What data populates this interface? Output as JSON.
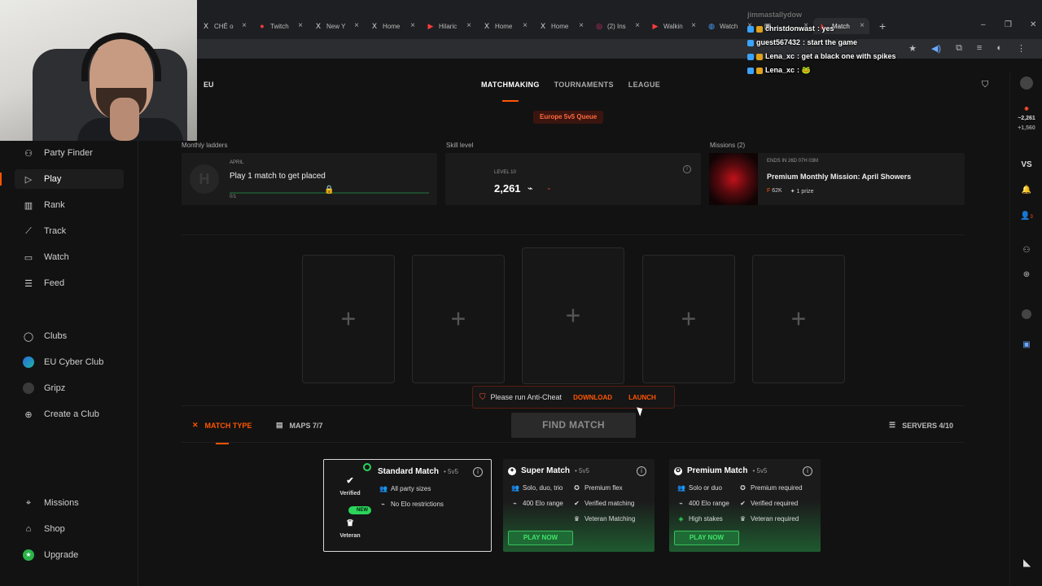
{
  "browser": {
    "tabs": [
      {
        "label": "CHÊ o",
        "icon": "x-icon",
        "fav": "X"
      },
      {
        "label": "Twitch",
        "icon": "reddit-icon",
        "fav": "●"
      },
      {
        "label": "New Y",
        "icon": "x-icon",
        "fav": "X"
      },
      {
        "label": "Home",
        "icon": "x-icon",
        "fav": "X"
      },
      {
        "label": "Hilaric",
        "icon": "youtube-icon",
        "fav": "▶"
      },
      {
        "label": "Home",
        "icon": "x-icon",
        "fav": "X"
      },
      {
        "label": "Home",
        "icon": "x-icon",
        "fav": "X"
      },
      {
        "label": "(2) Ins",
        "icon": "instagram-icon",
        "fav": "◎"
      },
      {
        "label": "Walkin",
        "icon": "youtube-icon",
        "fav": "▶"
      },
      {
        "label": "Watch",
        "icon": "globe-icon",
        "fav": "◍"
      },
      {
        "label": "",
        "icon": "twitch-icon",
        "fav": "▣"
      },
      {
        "label": "Match",
        "icon": "faceit-icon",
        "fav": "◣"
      }
    ],
    "new_tab": "+",
    "close_glyph": "×",
    "min_glyph": "–",
    "max_glyph": "❐",
    "close_win_glyph": "✕",
    "addr_icons": [
      "★",
      "◀)",
      "⧉",
      "≡",
      "◐",
      "⋮"
    ]
  },
  "chat": {
    "lines": [
      {
        "user": "jimmastallydow",
        "text": "",
        "faded": true
      },
      {
        "user": "christdonwast",
        "text": ": yes",
        "faded": false
      },
      {
        "user": "guest567432",
        "text": ": start the game",
        "faded": false
      },
      {
        "user": "Lena_xc",
        "text": ": get a black one with spikes",
        "faded": false
      },
      {
        "user": "Lena_xc",
        "text": ": 🐸",
        "faded": false
      }
    ]
  },
  "sidebar": {
    "items": [
      {
        "name": "party-finder",
        "label": "Party Finder",
        "icon": "⚇",
        "active": false
      },
      {
        "name": "play",
        "label": "Play",
        "icon": "▷",
        "active": true
      },
      {
        "name": "rank",
        "label": "Rank",
        "icon": "▥",
        "active": false
      },
      {
        "name": "track",
        "label": "Track",
        "icon": "⟋",
        "active": false
      },
      {
        "name": "watch",
        "label": "Watch",
        "icon": "▭",
        "active": false
      },
      {
        "name": "feed",
        "label": "Feed",
        "icon": "☰",
        "active": false
      },
      {
        "name": "clubs",
        "label": "Clubs",
        "icon": "◯",
        "active": false
      },
      {
        "name": "eu-cyber-club",
        "label": "EU Cyber Club",
        "icon": "",
        "active": false
      },
      {
        "name": "gripz",
        "label": "Gripz",
        "icon": "",
        "active": false
      },
      {
        "name": "create-club",
        "label": "Create a Club",
        "icon": "⊕",
        "active": false
      },
      {
        "name": "missions",
        "label": "Missions",
        "icon": "⌖",
        "active": false
      },
      {
        "name": "shop",
        "label": "Shop",
        "icon": "⌂",
        "active": false
      },
      {
        "name": "upgrade",
        "label": "Upgrade",
        "icon": "★",
        "active": false
      }
    ]
  },
  "header": {
    "region": "EU",
    "nav": [
      "MATCHMAKING",
      "TOURNAMENTS",
      "LEAGUE"
    ],
    "queue": "Europe 5v5 Queue",
    "shop_icon": "⛉"
  },
  "right_rail": {
    "elo": "~2,261",
    "elo_sub": "+1,560",
    "vs": "VS",
    "bell": "🔔",
    "friends": "👤",
    "notif_count": "3"
  },
  "stats": {
    "ladder": {
      "section": "Monthly ladders",
      "month": "APRIL",
      "title": "Play 1 match to get placed",
      "count": "0/1",
      "logo": "H",
      "lock": "🔒"
    },
    "skill": {
      "section": "Skill level",
      "level": "LEVEL 10",
      "elo": "2,261",
      "trend": "⌁",
      "arrow": "⌄",
      "info": "i"
    },
    "mission": {
      "section": "Missions (2)",
      "ends": "ENDS IN 26D 07H 03M",
      "title": "Premium Monthly Mission: April Showers",
      "points": "62K",
      "prize": "1 prize"
    }
  },
  "slots": [
    "+",
    "+",
    "+",
    "+",
    "+"
  ],
  "anticheat": {
    "text": "Please run Anti-Cheat",
    "download": "DOWNLOAD",
    "launch": "LAUNCH",
    "shield": "⛉"
  },
  "match_bar": {
    "match_type": "MATCH TYPE",
    "maps": "MAPS 7/7",
    "find": "FIND MATCH",
    "servers": "SERVERS 4/10"
  },
  "match_cards": [
    {
      "title": "Standard Match",
      "size": "• 5v5",
      "tiers": [
        {
          "label": "Verified",
          "icon": "✔"
        },
        {
          "label": "Veteran",
          "icon": "♛"
        }
      ],
      "new": "NEW",
      "features": [
        {
          "icon": "👥",
          "text": "All party sizes"
        },
        {
          "icon": "⌁",
          "text": "No Elo restrictions"
        }
      ]
    },
    {
      "title": "Super Match",
      "size": "• 5v5",
      "col1": [
        {
          "icon": "👥",
          "text": "Solo, duo, trio"
        },
        {
          "icon": "⌁",
          "text": "400 Elo range"
        }
      ],
      "col2": [
        {
          "icon": "✪",
          "text": "Premium flex"
        },
        {
          "icon": "✔",
          "text": "Verified matching"
        },
        {
          "icon": "♛",
          "text": "Veteran Matching"
        }
      ],
      "cta": "PLAY NOW"
    },
    {
      "title": "Premium Match",
      "size": "• 5v5",
      "col1": [
        {
          "icon": "👥",
          "text": "Solo or duo"
        },
        {
          "icon": "⌁",
          "text": "400 Elo range"
        },
        {
          "icon": "◈",
          "text": "High stakes"
        }
      ],
      "col2": [
        {
          "icon": "✪",
          "text": "Premium required"
        },
        {
          "icon": "✔",
          "text": "Verified required"
        },
        {
          "icon": "♛",
          "text": "Veteran required"
        }
      ],
      "cta": "PLAY NOW"
    }
  ],
  "colors": {
    "accent": "#ff5500",
    "green": "#2bd45a",
    "bg": "#121212"
  }
}
